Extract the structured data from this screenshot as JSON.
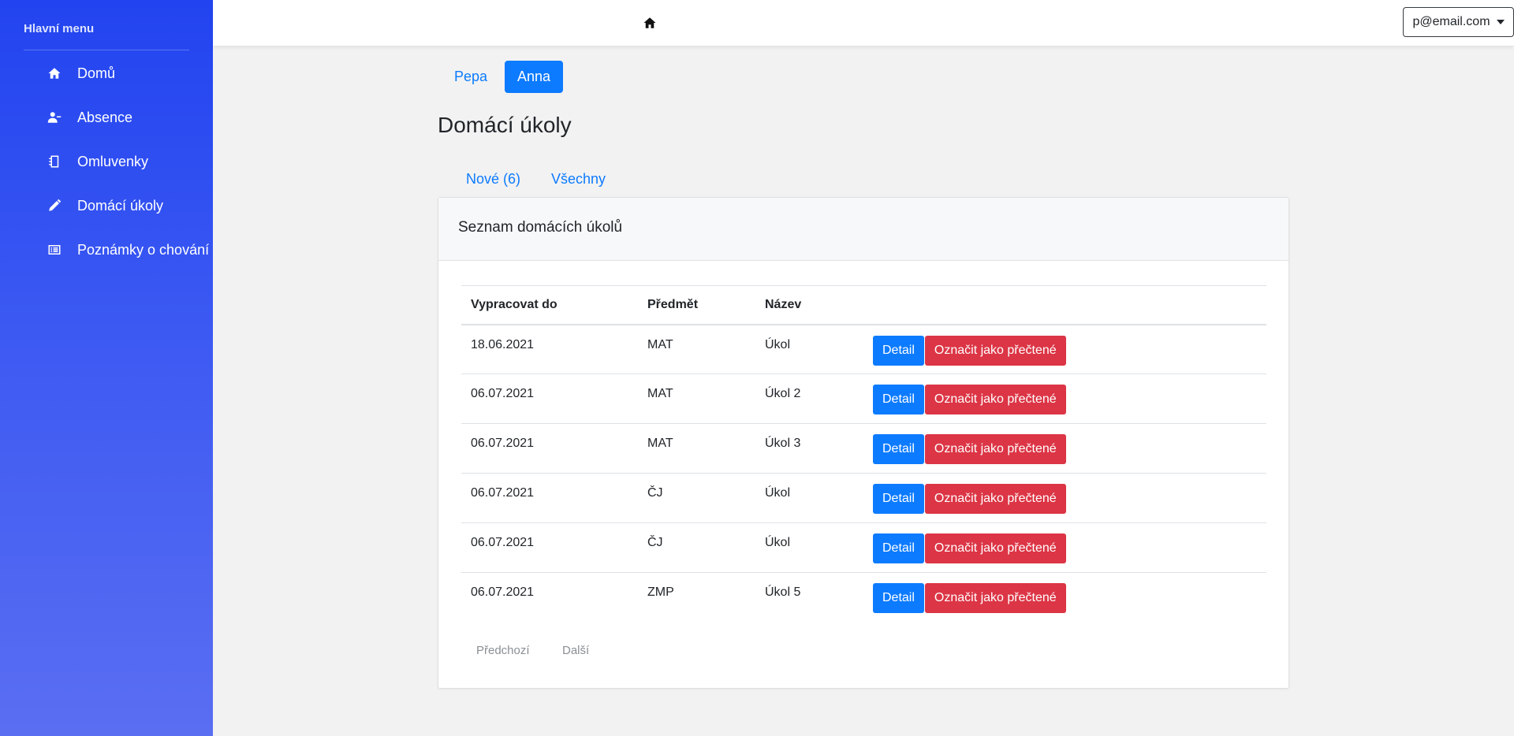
{
  "sidebar": {
    "heading": "Hlavní menu",
    "items": [
      {
        "label": "Domů",
        "icon": "home-icon"
      },
      {
        "label": "Absence",
        "icon": "user-minus-icon"
      },
      {
        "label": "Omluvenky",
        "icon": "notebook-icon"
      },
      {
        "label": "Domácí úkoly",
        "icon": "pencil-icon"
      },
      {
        "label": "Poznámky o chování",
        "icon": "list-icon"
      }
    ]
  },
  "topbar": {
    "home_icon": "home-icon",
    "user_email": "p@email.com"
  },
  "children": [
    {
      "label": "Pepa",
      "active": false
    },
    {
      "label": "Anna",
      "active": true
    }
  ],
  "page_title": "Domácí úkoly",
  "tabs": [
    {
      "label": "Nové (6)"
    },
    {
      "label": "Všechny"
    }
  ],
  "card": {
    "title": "Seznam domácích úkolů",
    "columns": [
      "Vypracovat do",
      "Předmět",
      "Název"
    ],
    "rows": [
      {
        "due": "18.06.2021",
        "subject": "MAT",
        "name": "Úkol"
      },
      {
        "due": "06.07.2021",
        "subject": "MAT",
        "name": "Úkol 2"
      },
      {
        "due": "06.07.2021",
        "subject": "MAT",
        "name": "Úkol 3"
      },
      {
        "due": "06.07.2021",
        "subject": "ČJ",
        "name": "Úkol"
      },
      {
        "due": "06.07.2021",
        "subject": "ČJ",
        "name": "Úkol"
      },
      {
        "due": "06.07.2021",
        "subject": "ZMP",
        "name": "Úkol 5"
      }
    ],
    "detail_label": "Detail",
    "mark_read_label": "Označit jako přečtené",
    "pagination": {
      "prev": "Předchozí",
      "next": "Další"
    }
  },
  "colors": {
    "primary": "#0d7bff",
    "danger": "#dc3545",
    "sidebar_top": "#2244f0",
    "sidebar_bottom": "#5a6ef2"
  }
}
